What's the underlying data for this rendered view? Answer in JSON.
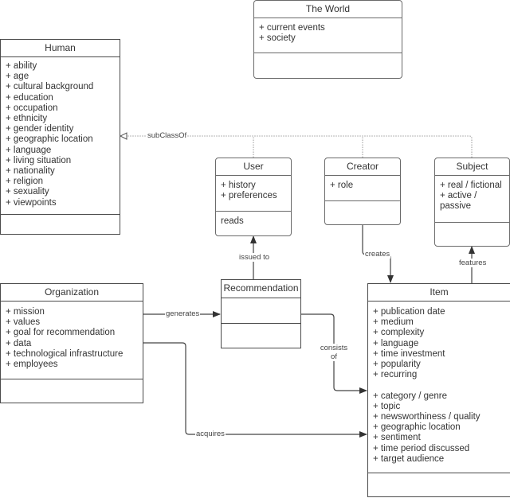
{
  "diagram": {
    "type": "UML class diagram",
    "classes": {
      "world": {
        "name": "The World",
        "attributes": [
          "+ current events",
          "+ society"
        ],
        "operations": []
      },
      "human": {
        "name": "Human",
        "attributes": [
          "+ ability",
          "+ age",
          "+ cultural background",
          "+ education",
          "+ occupation",
          "+ ethnicity",
          "+ gender identity",
          "+ geographic location",
          "+ language",
          "+ living situation",
          "+ nationality",
          "+ religion",
          "+ sexuality",
          "+ viewpoints"
        ],
        "operations": []
      },
      "user": {
        "name": "User",
        "attributes": [
          "+ history",
          "+ preferences"
        ],
        "operations": [
          "reads"
        ]
      },
      "creator": {
        "name": "Creator",
        "attributes": [
          "+ role"
        ],
        "operations": []
      },
      "subject": {
        "name": "Subject",
        "attributes": [
          "+ real / fictional",
          "+ active / passive"
        ],
        "operations": []
      },
      "organization": {
        "name": "Organization",
        "attributes": [
          "+ mission",
          "+ values",
          "+ goal for recommendation",
          "+ data",
          "+ technological infrastructure",
          "+ employees"
        ],
        "operations": []
      },
      "recommendation": {
        "name": "Recommendation",
        "attributes": [],
        "operations": []
      },
      "item": {
        "name": "Item",
        "attributes_group1": [
          "+ publication date",
          "+ medium",
          "+ complexity",
          "+ language",
          "+ time investment",
          "+ popularity",
          "+ recurring"
        ],
        "attributes_group2": [
          "+ category / genre",
          "+ topic",
          "+ newsworthiness / quality",
          "+ geographic location",
          "+ sentiment",
          "+ time period discussed",
          "+ target audience"
        ],
        "operations": []
      }
    },
    "relationships": [
      {
        "id": "subclassof",
        "label": "subClassOf",
        "from": [
          "User",
          "Creator",
          "Subject"
        ],
        "to": "Human",
        "style": "dotted-generalization"
      },
      {
        "id": "issued_to",
        "label": "issued to",
        "from": "Recommendation",
        "to": "User"
      },
      {
        "id": "creates",
        "label": "creates",
        "from": "Creator",
        "to": "Item"
      },
      {
        "id": "features",
        "label": "features",
        "from": "Item",
        "to": "Subject"
      },
      {
        "id": "generates",
        "label": "generates",
        "from": "Organization",
        "to": "Recommendation"
      },
      {
        "id": "consists_of",
        "label": "consists of",
        "label_lines": [
          "consists",
          "of"
        ],
        "from": "Recommendation",
        "to": "Item"
      },
      {
        "id": "acquires",
        "label": "acquires",
        "from": "Organization",
        "to": "Item"
      }
    ]
  }
}
